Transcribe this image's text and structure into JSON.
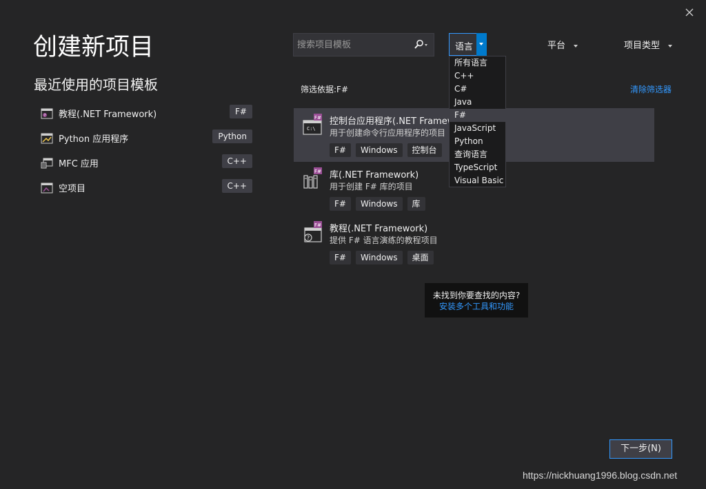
{
  "window": {
    "close_icon": "close-icon"
  },
  "header": {
    "title": "创建新项目"
  },
  "recent": {
    "title": "最近使用的项目模板",
    "items": [
      {
        "label": "教程(.NET Framework)",
        "tag": "F#",
        "icon": "tutorial-template-icon"
      },
      {
        "label": "Python 应用程序",
        "tag": "Python",
        "icon": "python-app-icon"
      },
      {
        "label": "MFC 应用",
        "tag": "C++",
        "icon": "mfc-app-icon"
      },
      {
        "label": "空项目",
        "tag": "C++",
        "icon": "empty-project-icon"
      }
    ]
  },
  "search": {
    "placeholder": "搜索项目模板",
    "value": ""
  },
  "filters": {
    "language": {
      "label": "语言",
      "options": [
        "所有语言",
        "C++",
        "C#",
        "Java",
        "F#",
        "JavaScript",
        "Python",
        "查询语言",
        "TypeScript",
        "Visual Basic"
      ],
      "selected": "F#"
    },
    "platform": {
      "label": "平台"
    },
    "project_type": {
      "label": "项目类型"
    }
  },
  "filter_status": {
    "label": "筛选依据:F#",
    "clear_label": "清除筛选器"
  },
  "templates": [
    {
      "title": "控制台应用程序(.NET Framework)",
      "desc": "用于创建命令行应用程序的项目",
      "tags": [
        "F#",
        "Windows",
        "控制台"
      ],
      "selected": true
    },
    {
      "title": "库(.NET Framework)",
      "desc": "用于创建 F# 库的项目",
      "tags": [
        "F#",
        "Windows",
        "库"
      ],
      "selected": false
    },
    {
      "title": "教程(.NET Framework)",
      "desc": "提供 F# 语言演练的教程项目",
      "tags": [
        "F#",
        "Windows",
        "桌面"
      ],
      "selected": false
    }
  ],
  "not_found": {
    "text": "未找到你要查找的内容?",
    "link": "安装多个工具和功能"
  },
  "footer": {
    "next_label": "下一步(N)"
  },
  "watermark": "https://nickhuang1996.blog.csdn.net",
  "colors": {
    "background": "#252526",
    "accent": "#3399ff",
    "selection": "#3f3f46",
    "fsharp_badge": "#9b4f96"
  }
}
